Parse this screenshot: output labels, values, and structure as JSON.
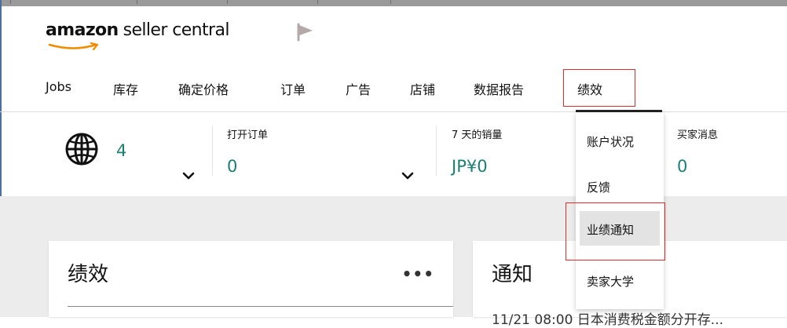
{
  "header": {
    "logo_brand": "amazon",
    "logo_rest": "seller central",
    "flag_icon": "flag-icon"
  },
  "nav": {
    "items": [
      {
        "label": "Jobs"
      },
      {
        "label": "库存"
      },
      {
        "label": "确定价格"
      },
      {
        "label": "订单"
      },
      {
        "label": "广告"
      },
      {
        "label": "店铺"
      },
      {
        "label": "数据报告"
      },
      {
        "label": "绩效"
      }
    ],
    "active_index": 7
  },
  "metrics": {
    "marketplaces": {
      "icon": "globe-icon",
      "value": "4"
    },
    "open_orders": {
      "title": "打开订单",
      "value": "0"
    },
    "sales_7d": {
      "title": "7 天的销量",
      "value": "JP¥0"
    },
    "buyer_messages": {
      "title": "买家消息",
      "value": "0"
    }
  },
  "dropdown": {
    "items": [
      {
        "label": "账户状况"
      },
      {
        "label": "反馈"
      },
      {
        "label": "业绩通知"
      },
      {
        "label": "卖家大学"
      }
    ],
    "highlighted_index": 2
  },
  "cards": {
    "performance": {
      "title": "绩效",
      "more": "•••"
    },
    "notifications": {
      "title": "通知",
      "peek": "11/21 08:00 日本消费税金额分开存..."
    }
  },
  "colors": {
    "accent_teal": "#1a7f74",
    "highlight_red": "#d9302c",
    "logo_smile": "#f08c00"
  }
}
